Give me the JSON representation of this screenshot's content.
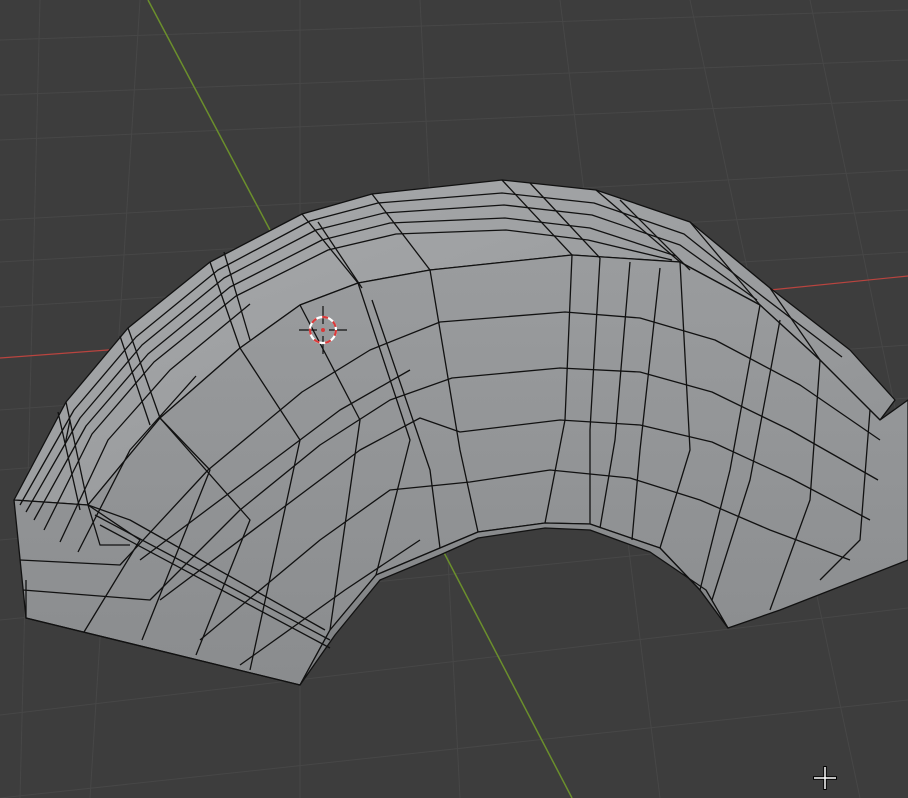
{
  "viewport": {
    "mode": "3D Viewport",
    "background": "#3d3d3d",
    "grid_color": "#474747",
    "x_axis_color": "#b9443f",
    "y_axis_color": "#6b8f2c"
  },
  "mesh": {
    "object": "arch",
    "face_color": "#8e9092",
    "face_highlight": "#a3a5a7",
    "face_shadow": "#7a7c7e",
    "edge_color": "#111111"
  },
  "cursor_3d": {
    "icon": "3d-cursor-icon",
    "ring_color": "#d93a3a"
  },
  "mouse_cursor": {
    "icon": "crosshair-cursor-icon"
  }
}
